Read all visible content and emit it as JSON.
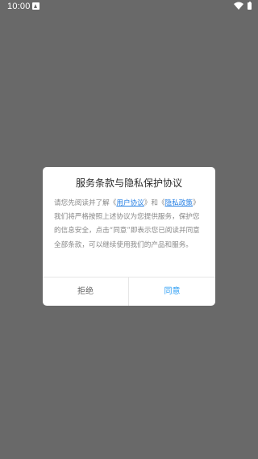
{
  "status_bar": {
    "time": "10:00",
    "icons": [
      "notification-icon",
      "wifi-icon",
      "battery-icon"
    ]
  },
  "dialog": {
    "title": "服务条款与隐私保护协议",
    "body_prefix": "请您先阅读并了解《",
    "user_agreement_link": "用户协议",
    "body_mid": "》和《",
    "privacy_policy_link": "隐私政策",
    "body_suffix": "》我们将严格按照上述协议为您提供服务，保护您的信息安全，点击“同意”即表示您已阅读并同意全部条款，可以继续使用我们的产品和服务。",
    "refuse_label": "拒绝",
    "agree_label": "同意"
  },
  "colors": {
    "overlay_background": "#696969",
    "link": "#2a82e4",
    "agree": "#2a9df4",
    "refuse": "#666666"
  }
}
